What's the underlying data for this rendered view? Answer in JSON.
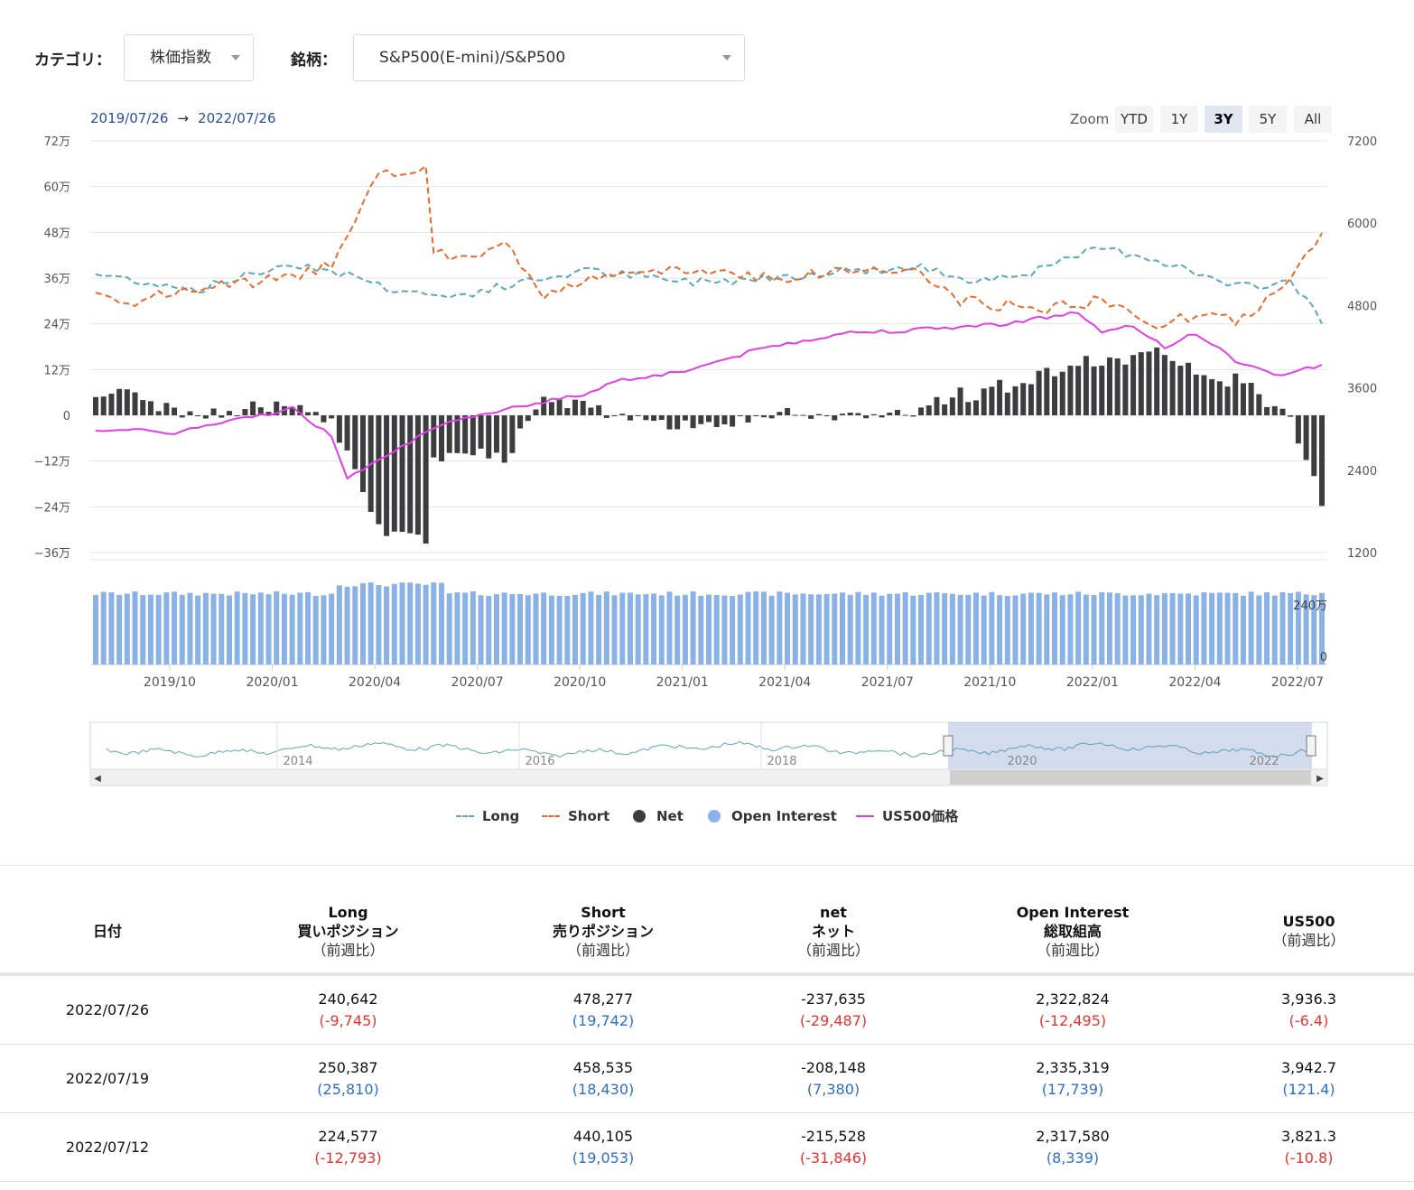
{
  "filters": {
    "category_label": "カテゴリ：",
    "category_value": "株価指数",
    "symbol_label": "銘柄：",
    "symbol_value": "S&P500(E-mini)/S&P500"
  },
  "range": {
    "from": "2019/07/26",
    "arrow": "→",
    "to": "2022/07/26"
  },
  "zoom": {
    "label": "Zoom",
    "buttons": [
      "YTD",
      "1Y",
      "3Y",
      "5Y",
      "All"
    ],
    "active": "3Y"
  },
  "legend": {
    "long": "Long",
    "short": "Short",
    "net": "Net",
    "oi": "Open Interest",
    "price": "US500価格"
  },
  "colors": {
    "long": "#5aa9b8",
    "short": "#ea6a2c",
    "net": "#3d3d3f",
    "oi": "#8ab2e6",
    "price": "#e33de3",
    "negative": "#e3342f",
    "positive": "#2f6fc4"
  },
  "chart_data": {
    "type": "line",
    "left_axis_ticks": [
      "72万",
      "60万",
      "48万",
      "36万",
      "24万",
      "12万",
      "0",
      "−12万",
      "−24万",
      "−36万"
    ],
    "right_axis_ticks": [
      "7200",
      "6000",
      "4800",
      "3600",
      "2400",
      "1200"
    ],
    "oi_axis_ticks": [
      "240万",
      "0"
    ],
    "x_tick_labels": [
      "2019/10",
      "2020/01",
      "2020/04",
      "2020/07",
      "2020/10",
      "2021/01",
      "2021/04",
      "2021/07",
      "2021/10",
      "2022/01",
      "2022/04",
      "2022/07"
    ],
    "navigator_labels": [
      "2014",
      "2016",
      "2018",
      "2020",
      "2022"
    ],
    "left_ylim": [
      -360000,
      720000
    ],
    "right_ylim": [
      1200,
      7200
    ],
    "series": [
      {
        "name": "Long",
        "unit": "contracts",
        "values": [
          370000,
          372000,
          385000,
          350000,
          340000,
          362000,
          345000,
          355000,
          360000,
          340000,
          332000,
          350000,
          362000,
          368000,
          380000,
          372000,
          390000,
          392000,
          380000,
          375000,
          392000,
          398000,
          388000,
          375000,
          380000,
          390000,
          400000,
          410000,
          420000,
          430000,
          440000,
          430000,
          455000,
          425000,
          410000,
          395000,
          370000,
          368000,
          360000,
          340000,
          330000,
          312000,
          300000,
          305000,
          320000,
          345000,
          360000,
          350000,
          335000,
          345000,
          352000,
          358000,
          365000,
          370000,
          382000,
          392000,
          400000,
          408000,
          395000,
          380000,
          365000,
          350000,
          345000,
          350000,
          352000,
          355000,
          358000,
          360000,
          362000,
          355000,
          350000,
          345000,
          352000,
          358000,
          360000,
          365000,
          372000,
          378000,
          385000,
          385000,
          380000,
          375000,
          370000,
          368000,
          360000,
          345000,
          338000,
          330000,
          340000,
          350000,
          352000,
          360000,
          375000,
          390000,
          402000,
          412000,
          420000,
          430000,
          425000,
          415000,
          405000,
          395000,
          388000,
          380000,
          376000,
          370000,
          366000,
          364000,
          360000,
          366000,
          370000,
          380000,
          390000,
          405000,
          415000,
          425000,
          435000,
          445000,
          440000,
          430000,
          420000,
          410000,
          400000,
          395000,
          392000,
          400000,
          420000,
          440000,
          450000,
          440000,
          430000,
          420000,
          410000,
          400000,
          392000,
          385000,
          380000,
          375000,
          370000,
          362000,
          356000,
          352000,
          345000,
          338000,
          330000,
          325000,
          320000,
          328000,
          336000,
          344000,
          350000,
          355000,
          360000,
          358000,
          352000,
          345000,
          340000,
          336000,
          330000,
          326000,
          320000,
          315000,
          312000,
          318000,
          326000,
          334000,
          340000,
          345000,
          350000,
          355000,
          360000,
          356000,
          350000,
          346000,
          342000,
          338000,
          330000,
          322000,
          312000,
          300000,
          282000,
          268000,
          260000,
          255000,
          250642,
          250387,
          224577,
          240642
        ],
        "note": ""
      },
      {
        "name": "Short",
        "values": []
      },
      {
        "name": "Net",
        "values": []
      },
      {
        "name": "Open Interest",
        "values": []
      },
      {
        "name": "US500価格",
        "values": []
      }
    ]
  },
  "table": {
    "headers": [
      {
        "line1": "日付",
        "line2": "",
        "line3": ""
      },
      {
        "line1": "Long",
        "line2": "買いポジション",
        "line3": "（前週比）"
      },
      {
        "line1": "Short",
        "line2": "売りポジション",
        "line3": "（前週比）"
      },
      {
        "line1": "net",
        "line2": "ネット",
        "line3": "（前週比）"
      },
      {
        "line1": "Open Interest",
        "line2": "総取組高",
        "line3": "（前週比）"
      },
      {
        "line1": "US500",
        "line2": "（前週比）",
        "line3": ""
      }
    ],
    "rows": [
      {
        "date": "2022/07/26",
        "long": "240,642",
        "long_chg": "(-9,745)",
        "short": "478,277",
        "short_chg": "(19,742)",
        "net": "-237,635",
        "net_chg": "(-29,487)",
        "oi": "2,322,824",
        "oi_chg": "(-12,495)",
        "px": "3,936.3",
        "px_chg": "(-6.4)"
      },
      {
        "date": "2022/07/19",
        "long": "250,387",
        "long_chg": "(25,810)",
        "short": "458,535",
        "short_chg": "(18,430)",
        "net": "-208,148",
        "net_chg": "(7,380)",
        "oi": "2,335,319",
        "oi_chg": "(17,739)",
        "px": "3,942.7",
        "px_chg": "(121.4)"
      },
      {
        "date": "2022/07/12",
        "long": "224,577",
        "long_chg": "(-12,793)",
        "short": "440,105",
        "short_chg": "(19,053)",
        "net": "-215,528",
        "net_chg": "(-31,846)",
        "oi": "2,317,580",
        "oi_chg": "(8,339)",
        "px": "3,821.3",
        "px_chg": "(-10.8)"
      }
    ]
  }
}
